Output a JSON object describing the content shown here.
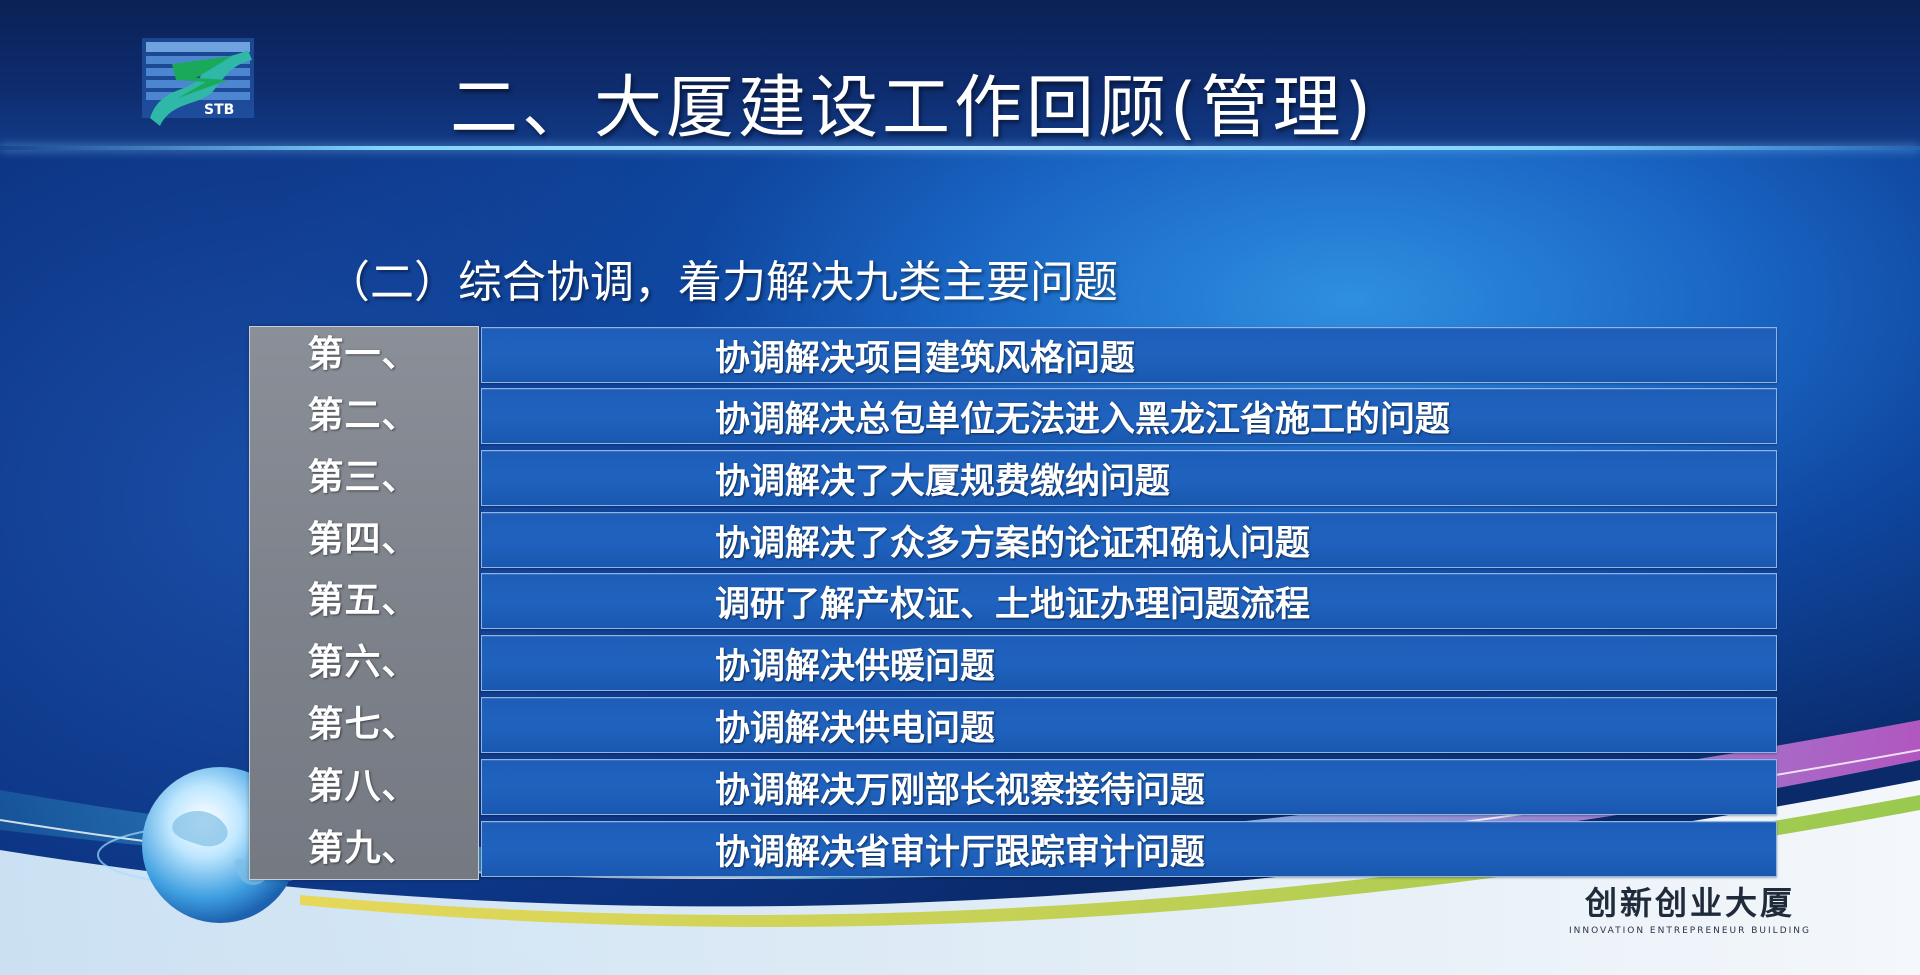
{
  "header": {
    "title": "二、大厦建设工作回顾(管理)",
    "logo_text": "STB"
  },
  "subtitle": "（二）综合协调，着力解决九类主要问题",
  "items": [
    {
      "label": "第一、",
      "text": "协调解决项目建筑风格问题"
    },
    {
      "label": "第二、",
      "text": "协调解决总包单位无法进入黑龙江省施工的问题"
    },
    {
      "label": "第三、",
      "text": "协调解决了大厦规费缴纳问题"
    },
    {
      "label": "第四、",
      "text": "协调解决了众多方案的论证和确认问题"
    },
    {
      "label": "第五、",
      "text": "调研了解产权证、土地证办理问题流程"
    },
    {
      "label": "第六、",
      "text": "协调解决供暖问题"
    },
    {
      "label": "第七、",
      "text": "协调解决供电问题"
    },
    {
      "label": "第八、",
      "text": "协调解决万刚部长视察接待问题"
    },
    {
      "label": "第九、",
      "text": "协调解决省审计厅跟踪审计问题"
    }
  ],
  "brand": {
    "cn": "创新创业大厦",
    "en": "INNOVATION ENTREPRENEUR BUILDING"
  },
  "colors": {
    "header_bg": "#0e2c6e",
    "row_bg": "#1f63bf",
    "label_col_bg": "#7d828b",
    "rule": "#b9e6ff"
  }
}
